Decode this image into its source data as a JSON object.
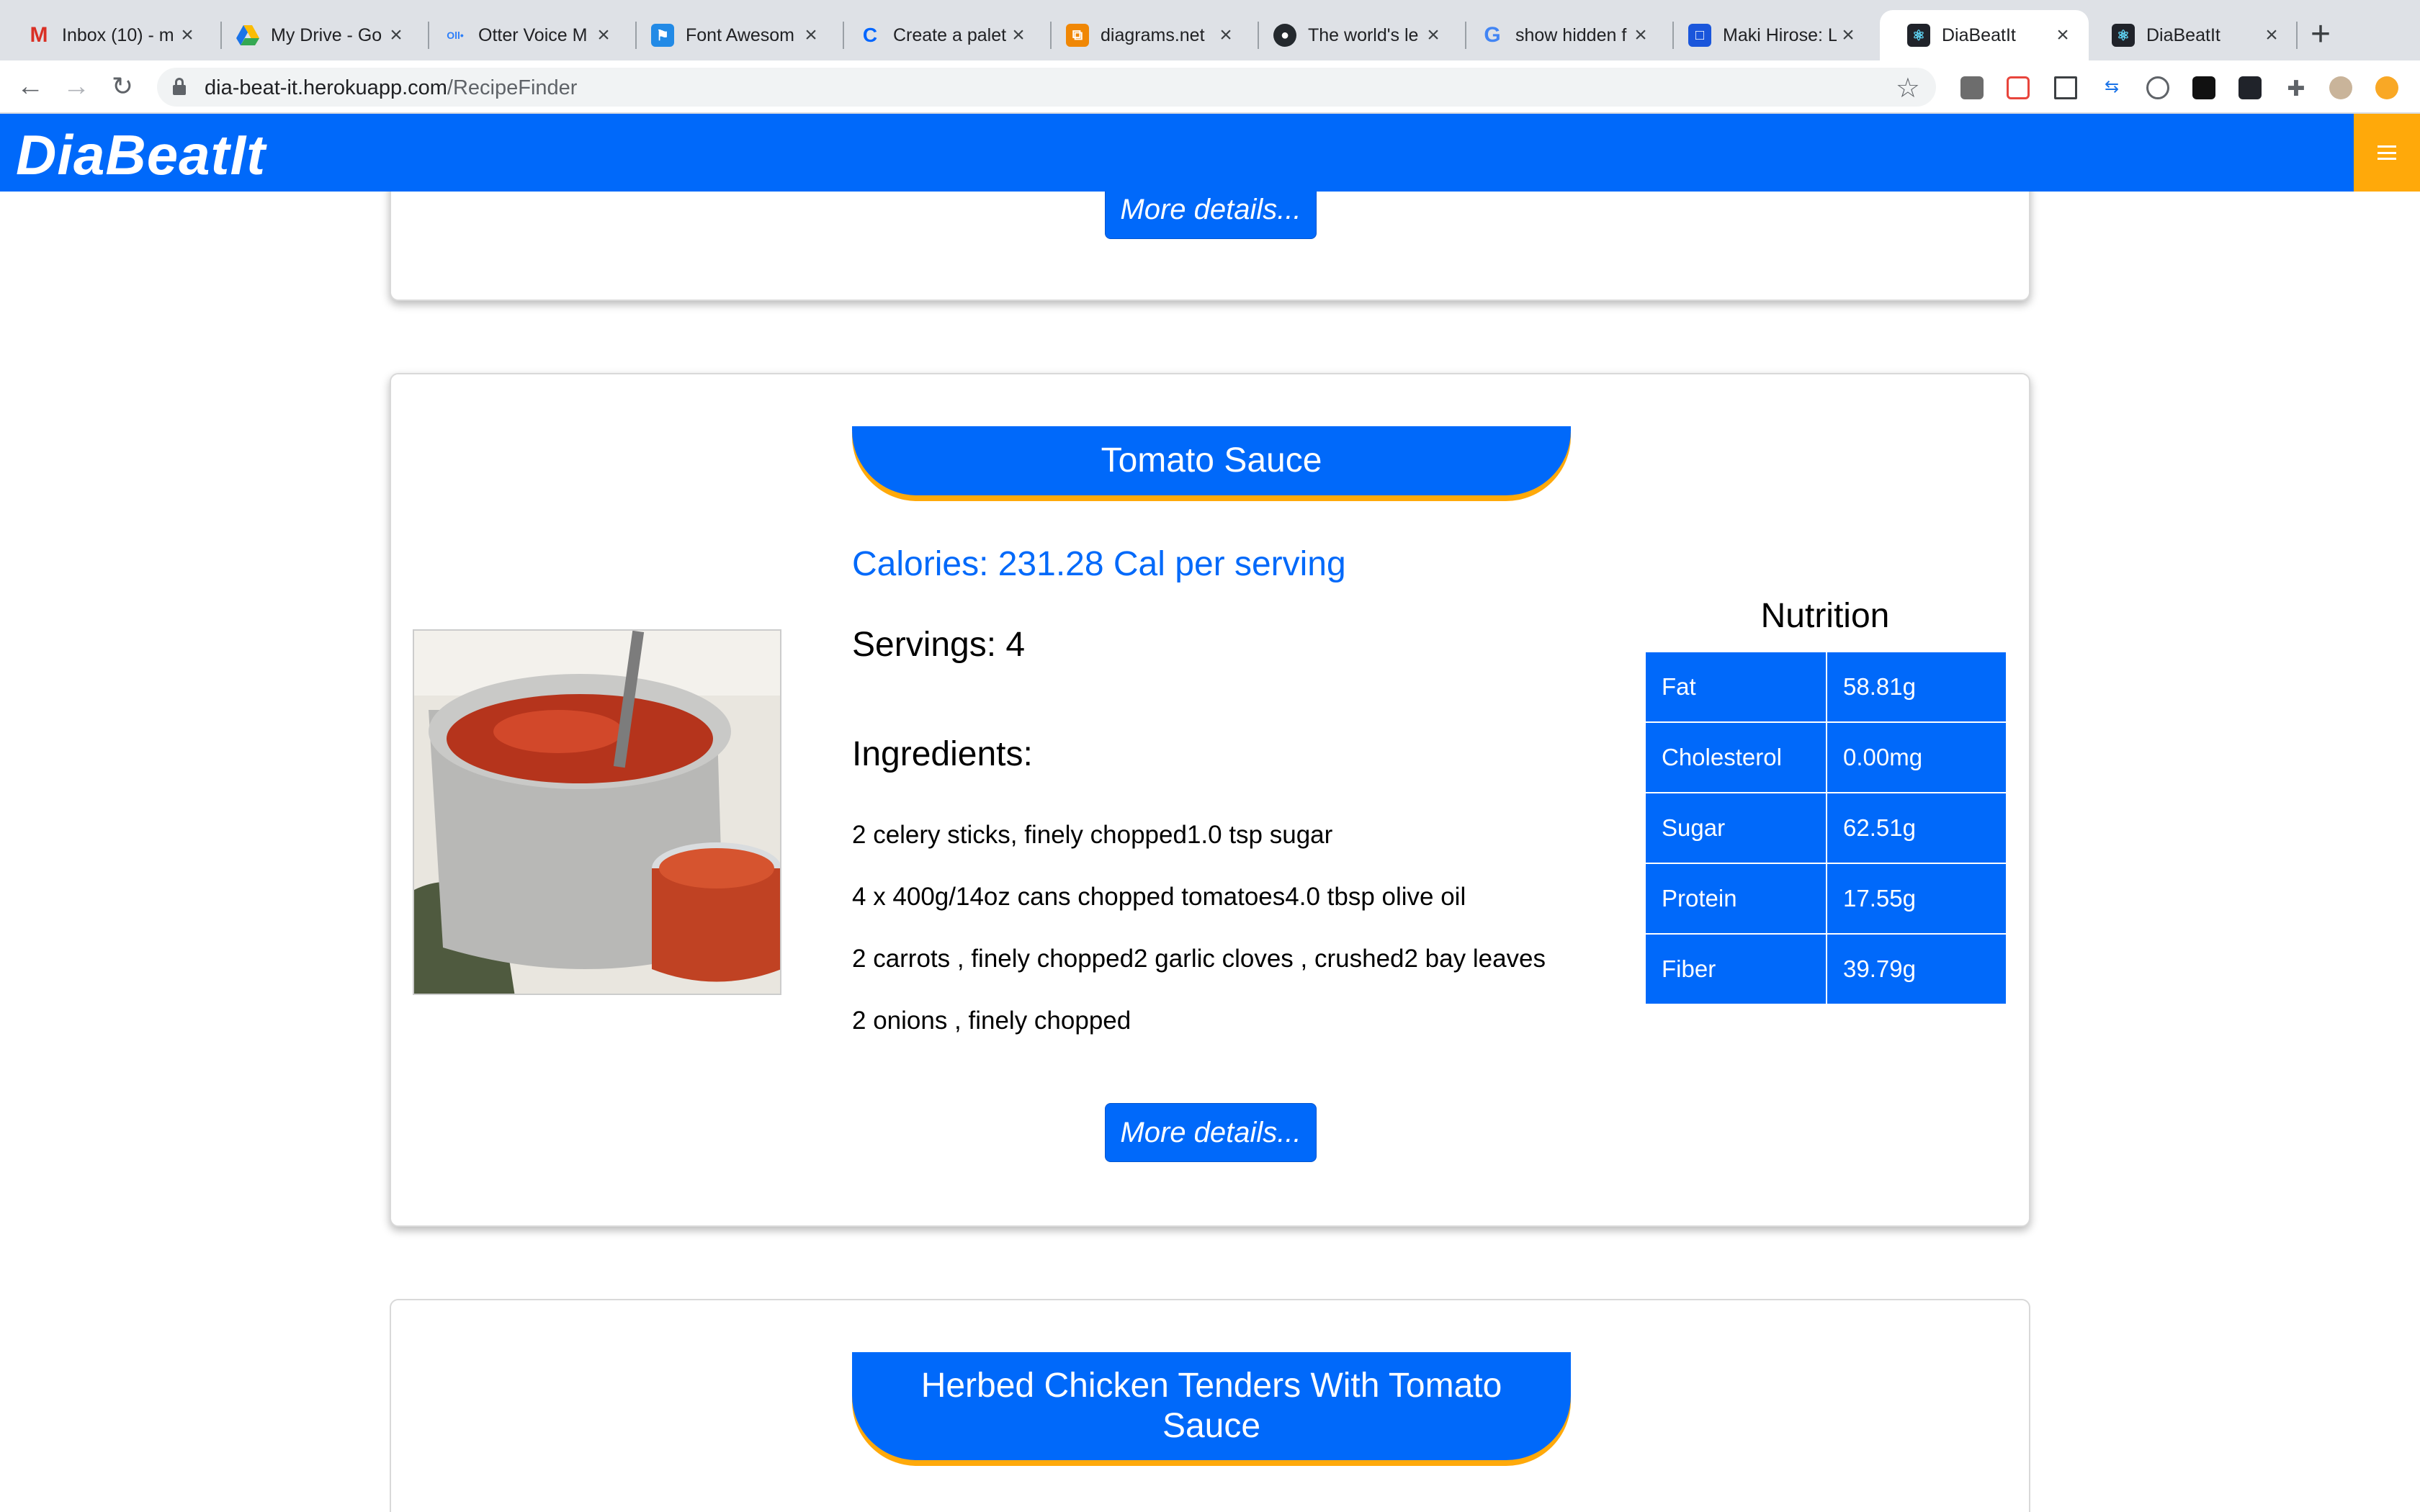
{
  "browser": {
    "tabs": [
      {
        "title": "Inbox (10) - m",
        "icon": "gmail-icon",
        "color": "#ffffff"
      },
      {
        "title": "My Drive - Go",
        "icon": "google-drive-icon",
        "color": "#ffffff"
      },
      {
        "title": "Otter Voice M",
        "icon": "otter-icon",
        "color": "#ffffff"
      },
      {
        "title": "Font Awesom",
        "icon": "font-awesome-icon",
        "color": "#228ae6"
      },
      {
        "title": "Create a palet",
        "icon": "coolors-icon",
        "color": "#ffffff"
      },
      {
        "title": "diagrams.net",
        "icon": "diagrams-icon",
        "color": "#f08705"
      },
      {
        "title": "The world's le",
        "icon": "github-icon",
        "color": "#ffffff"
      },
      {
        "title": "show hidden f",
        "icon": "google-icon",
        "color": "#ffffff"
      },
      {
        "title": "Maki Hirose: L",
        "icon": "profile-square-icon",
        "color": "#1a56db"
      },
      {
        "title": "DiaBeatIt",
        "icon": "react-icon",
        "color": "#20232a",
        "active": true
      },
      {
        "title": "DiaBeatIt",
        "icon": "react-icon",
        "color": "#20232a"
      }
    ],
    "url_host": "dia-beat-it.herokuapp.com",
    "url_path": "/RecipeFinder"
  },
  "app": {
    "brand": "DiaBeatIt",
    "colors": {
      "primary": "#0069fa",
      "accent": "#ffa90a"
    }
  },
  "recipes": {
    "previous": {
      "more_label": "More details..."
    },
    "current": {
      "title": "Tomato Sauce",
      "calories": "Calories: 231.28 Cal per serving",
      "servings": "Servings: 4",
      "ingredients_heading": "Ingredients:",
      "ingredients": [
        "2 celery sticks, finely chopped1.0 tsp sugar",
        "4 x 400g/14oz cans chopped tomatoes4.0 tbsp olive oil",
        "2 carrots , finely chopped2 garlic cloves , crushed2 bay leaves",
        "2 onions , finely chopped"
      ],
      "nutrition_heading": "Nutrition",
      "nutrition": [
        {
          "label": "Fat",
          "value": "58.81g"
        },
        {
          "label": "Cholesterol",
          "value": "0.00mg"
        },
        {
          "label": "Sugar",
          "value": "62.51g"
        },
        {
          "label": "Protein",
          "value": "17.55g"
        },
        {
          "label": "Fiber",
          "value": "39.79g"
        }
      ],
      "more_label": "More details..."
    },
    "next": {
      "title_line1": "Herbed Chicken Tenders With Tomato",
      "title_line2": "Sauce"
    }
  }
}
